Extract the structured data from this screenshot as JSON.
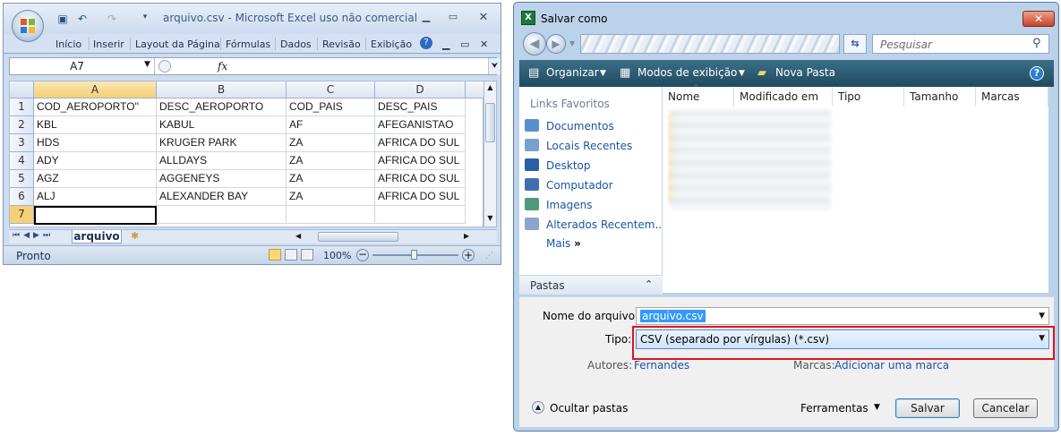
{
  "excel": {
    "title": "arquivo.csv - Microsoft Excel uso não comercial",
    "ribbon_tabs": [
      "Início",
      "Inserir",
      "Layout da Página",
      "Fórmulas",
      "Dados",
      "Revisão",
      "Exibição"
    ],
    "name_box": "A7",
    "fx": "fx",
    "columns": [
      "A",
      "B",
      "C",
      "D"
    ],
    "rows": [
      {
        "num": "1",
        "cells": [
          "COD_AEROPORTO\"",
          "DESC_AEROPORTO",
          "COD_PAIS",
          "DESC_PAIS"
        ]
      },
      {
        "num": "2",
        "cells": [
          "KBL",
          "KABUL",
          "AF",
          "AFEGANISTAO"
        ]
      },
      {
        "num": "3",
        "cells": [
          "HDS",
          "KRUGER PARK",
          "ZA",
          "AFRICA DO SUL"
        ]
      },
      {
        "num": "4",
        "cells": [
          "ADY",
          "ALLDAYS",
          "ZA",
          "AFRICA DO SUL"
        ]
      },
      {
        "num": "5",
        "cells": [
          "AGZ",
          "AGGENEYS",
          "ZA",
          "AFRICA DO SUL"
        ]
      },
      {
        "num": "6",
        "cells": [
          "ALJ",
          "ALEXANDER BAY",
          "ZA",
          "AFRICA DO SUL"
        ]
      },
      {
        "num": "7",
        "cells": [
          "",
          "",
          "",
          ""
        ]
      }
    ],
    "sheet_tab": "arquivo",
    "status": "Pronto",
    "zoom": "100%"
  },
  "dialog": {
    "title": "Salvar como",
    "search_placeholder": "Pesquisar",
    "toolbar": {
      "organize": "Organizar",
      "views": "Modos de exibição",
      "new_folder": "Nova Pasta"
    },
    "favorites_header": "Links Favoritos",
    "favorites": [
      "Documentos",
      "Locais Recentes",
      "Desktop",
      "Computador",
      "Imagens",
      "Alterados Recentem...",
      "Mais"
    ],
    "folders_label": "Pastas",
    "file_columns": [
      "Nome",
      "Modificado em",
      "Tipo",
      "Tamanho",
      "Marcas"
    ],
    "filename_label": "Nome do arquivo:",
    "filename_value": "arquivo.csv",
    "type_label": "Tipo:",
    "type_value": "CSV (separado por vírgulas) (*.csv)",
    "authors_label": "Autores:",
    "authors_value": "Fernandes",
    "tags_label": "Marcas:",
    "tags_value": "Adicionar uma marca",
    "hide_folders": "Ocultar pastas",
    "tools": "Ferramentas",
    "save": "Salvar",
    "cancel": "Cancelar"
  }
}
